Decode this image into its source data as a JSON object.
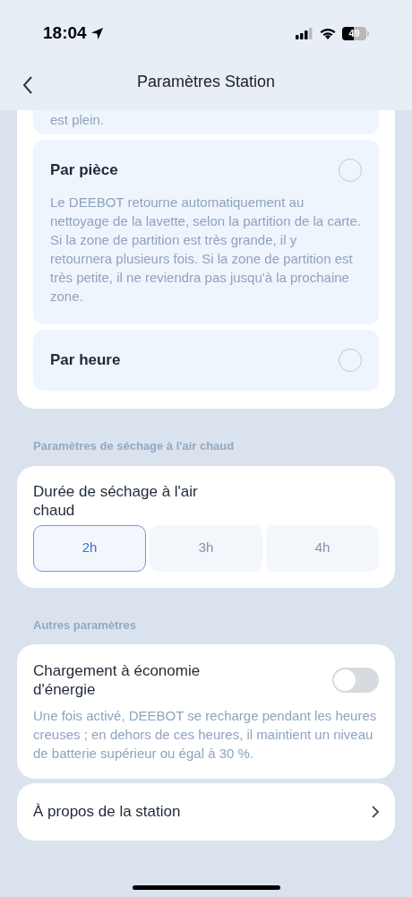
{
  "status_bar": {
    "time": "18:04",
    "battery": "49"
  },
  "header": {
    "title": "Paramètres Station"
  },
  "return_modes": [
    {
      "description": "est plein."
    },
    {
      "title": "Par pièce",
      "selected": false,
      "description": "Le DEEBOT retourne automatiquement au nettoyage de la lavette, selon la partition de la carte. Si la zone de partition est très grande, il y retournera plusieurs fois. Si la zone de partition est très petite, il ne reviendra pas jusqu'à la prochaine zone."
    },
    {
      "title": "Par heure",
      "selected": false
    }
  ],
  "drying": {
    "section": "Paramètres de séchage à l'air chaud",
    "title": "Durée de séchage à l'air chaud",
    "options": [
      {
        "label": "2h",
        "selected": true
      },
      {
        "label": "3h",
        "selected": false
      },
      {
        "label": "4h",
        "selected": false
      }
    ]
  },
  "other": {
    "section": "Autres paramètres",
    "eco_charging": {
      "title": "Chargement à économie d'énergie",
      "on": false,
      "description": "Une fois activé, DEEBOT se recharge pendant les heures creuses ; en dehors de ces heures, il maintient un niveau de batterie supérieur ou égal à 30 %."
    },
    "about": {
      "title": "À propos de la station"
    }
  }
}
